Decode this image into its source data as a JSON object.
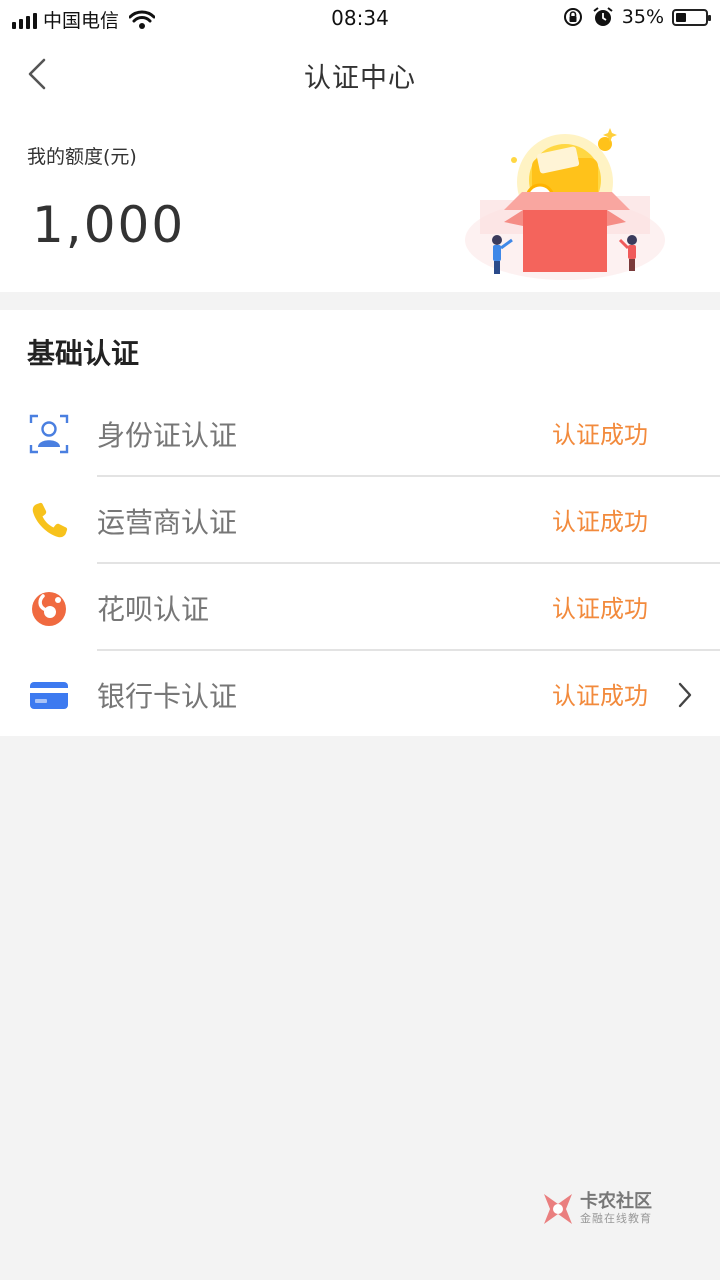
{
  "status_bar": {
    "carrier": "中国电信",
    "time": "08:34",
    "battery_percent_label": "35%",
    "battery_level": 0.35
  },
  "nav": {
    "title": "认证中心"
  },
  "credit": {
    "label": "我的额度(元)",
    "amount": "1,000"
  },
  "auth_section": {
    "title": "基础认证",
    "items": [
      {
        "label": "身份证认证",
        "status": "认证成功",
        "icon": "id-card-icon"
      },
      {
        "label": "运营商认证",
        "status": "认证成功",
        "icon": "phone-icon"
      },
      {
        "label": "花呗认证",
        "status": "认证成功",
        "icon": "huabei-icon"
      },
      {
        "label": "银行卡认证",
        "status": "认证成功",
        "icon": "bank-card-icon"
      }
    ]
  },
  "watermark": {
    "title": "卡农社区",
    "subtitle": "金融在线教育"
  },
  "colors": {
    "status_success": "#f28a3c",
    "id_icon": "#4a7fe0",
    "phone_icon": "#f7c21c",
    "huabei_icon": "#f06a40",
    "bank_icon": "#3d7af0"
  }
}
